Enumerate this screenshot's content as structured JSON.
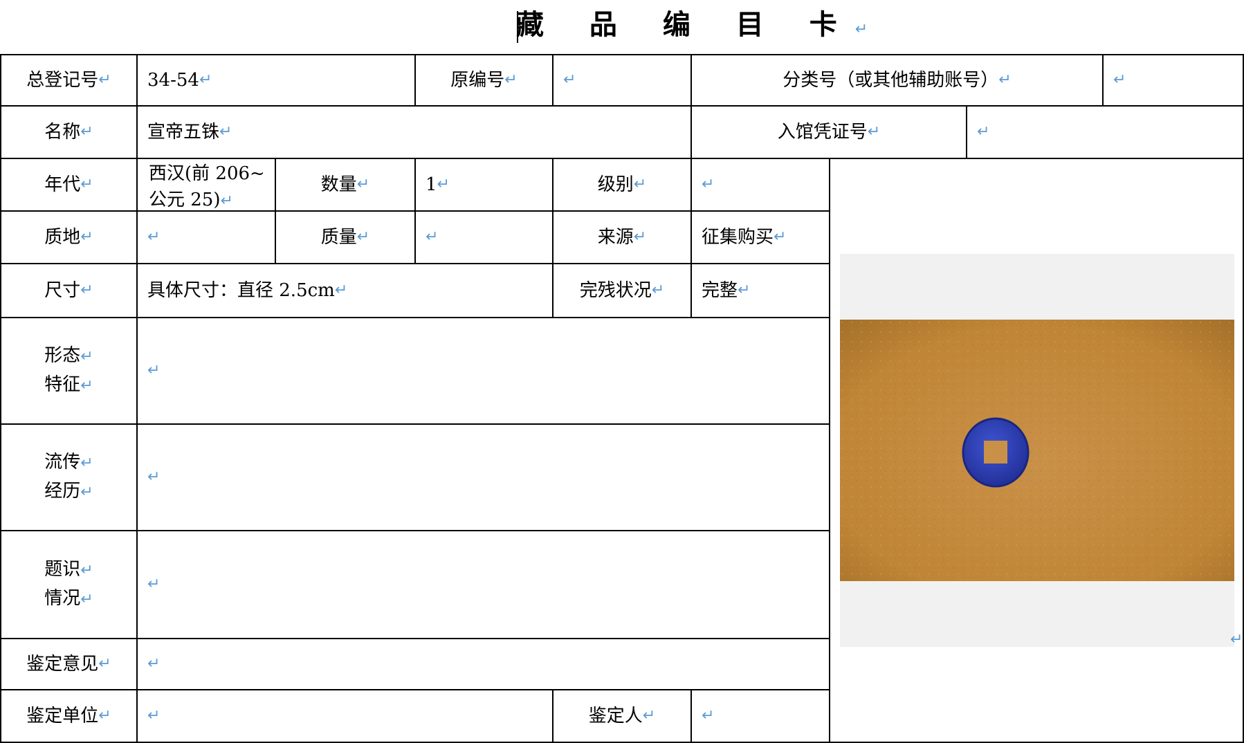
{
  "title": "藏 品 编 目 卡",
  "pm": "↵",
  "rows": {
    "reg_no_label": "总登记号",
    "reg_no": "34-54",
    "orig_no_label": "原编号",
    "orig_no": "",
    "class_no_label": "分类号（或其他辅助账号）",
    "class_no": "",
    "name_label": "名称",
    "name": "宣帝五铢",
    "voucher_label": "入馆凭证号",
    "voucher": "",
    "era_label": "年代",
    "era": "西汉(前 206~公元 25)",
    "qty_label": "数量",
    "qty": "1",
    "grade_label": "级别",
    "grade": "",
    "material_label": "质地",
    "material": "",
    "weight_label": "质量",
    "weight": "",
    "source_label": "来源",
    "source": "征集购买",
    "size_label": "尺寸",
    "size": "具体尺寸：直径 2.5cm",
    "condition_label": "完残状况",
    "condition": "完整",
    "shape_label_1": "形态",
    "shape_label_2": "特征",
    "shape": "",
    "history_label_1": "流传",
    "history_label_2": "经历",
    "history": "",
    "inscr_label_1": "题识",
    "inscr_label_2": "情况",
    "inscr": "",
    "opinion_label": "鉴定意见",
    "opinion": "",
    "unit_label": "鉴定单位",
    "unit": "",
    "appraiser_label": "鉴定人",
    "appraiser": ""
  },
  "colors": {
    "border": "#000000",
    "paragraph_mark": "#5b9bd5",
    "photo_cloth": "#c48a3a",
    "coin": "#2f3fb0"
  }
}
